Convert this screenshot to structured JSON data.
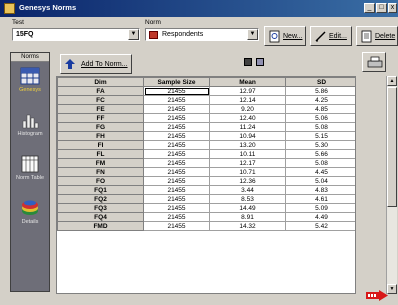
{
  "window": {
    "title": "Genesys Norms"
  },
  "test": {
    "label": "Test",
    "value": "15FQ"
  },
  "norms": {
    "label": "Norm",
    "value": "Respondents"
  },
  "buttons": {
    "new": "New...",
    "edit": "Edit...",
    "delete": "Delete",
    "add_to_norm": "Add To Norm..."
  },
  "sidebar": {
    "header": "Norms",
    "items": [
      {
        "label": "Genesys",
        "icon": "grid-icon"
      },
      {
        "label": "Histogram",
        "icon": "histogram-icon"
      },
      {
        "label": "Norm Table",
        "icon": "norm-table-icon"
      },
      {
        "label": "Details",
        "icon": "details-icon"
      }
    ]
  },
  "table": {
    "columns": [
      "Dim",
      "Sample Size",
      "Mean",
      "SD"
    ],
    "rows": [
      [
        "FA",
        "21455",
        "12.97",
        "5.86"
      ],
      [
        "FC",
        "21455",
        "12.14",
        "4.25"
      ],
      [
        "FE",
        "21455",
        "9.20",
        "4.85"
      ],
      [
        "FF",
        "21455",
        "12.40",
        "5.06"
      ],
      [
        "FG",
        "21455",
        "11.24",
        "5.08"
      ],
      [
        "FH",
        "21455",
        "10.94",
        "5.15"
      ],
      [
        "FI",
        "21455",
        "13.20",
        "5.30"
      ],
      [
        "FL",
        "21455",
        "10.11",
        "5.66"
      ],
      [
        "FM",
        "21455",
        "12.17",
        "5.08"
      ],
      [
        "FN",
        "21455",
        "10.71",
        "4.45"
      ],
      [
        "FO",
        "21455",
        "12.36",
        "5.04"
      ],
      [
        "FQ1",
        "21455",
        "3.44",
        "4.83"
      ],
      [
        "FQ2",
        "21455",
        "8.53",
        "4.61"
      ],
      [
        "FQ3",
        "21455",
        "14.49",
        "5.09"
      ],
      [
        "FQ4",
        "21455",
        "8.91",
        "4.49"
      ],
      [
        "FMD",
        "21455",
        "14.32",
        "5.42"
      ]
    ]
  },
  "colors": {
    "title_start": "#0a246a",
    "title_end": "#3a6ea5",
    "sidebar_bg": "#6e6e78",
    "active_label": "#f0d040",
    "next_arrow": "#d81818"
  }
}
